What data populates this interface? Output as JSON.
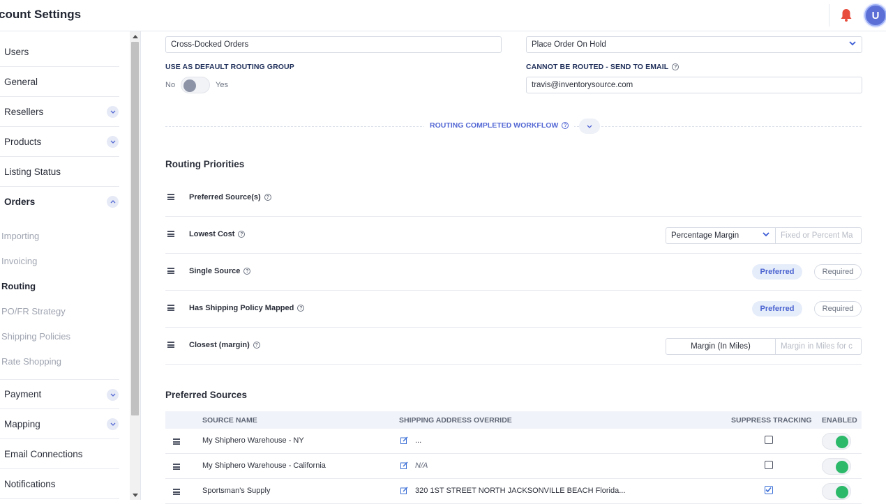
{
  "header": {
    "title": "count Settings",
    "avatar_letter": "U",
    "bell_color": "#e74c3c"
  },
  "sidebar": {
    "items": [
      {
        "label": "Users"
      },
      {
        "label": "General"
      },
      {
        "label": "Resellers"
      },
      {
        "label": "Products"
      },
      {
        "label": "Listing Status"
      },
      {
        "label": "Orders"
      },
      {
        "label": "Payment"
      },
      {
        "label": "Mapping"
      },
      {
        "label": "Email Connections"
      },
      {
        "label": "Notifications"
      }
    ],
    "sub_items": [
      {
        "label": "Importing"
      },
      {
        "label": "Invoicing"
      },
      {
        "label": "Routing"
      },
      {
        "label": "PO/FR Strategy"
      },
      {
        "label": "Shipping Policies"
      },
      {
        "label": "Rate Shopping"
      }
    ]
  },
  "form": {
    "group_name_value": "Cross-Docked Orders",
    "hold_select_value": "Place Order On Hold",
    "default_group_label": "USE AS DEFAULT ROUTING GROUP",
    "toggle_no": "No",
    "toggle_yes": "Yes",
    "default_group_enabled": false,
    "cannot_route_label": "CANNOT BE ROUTED - SEND TO EMAIL",
    "email_value": "travis@inventorysource.com",
    "workflow_label": "ROUTING COMPLETED WORKFLOW"
  },
  "priorities": {
    "title": "Routing Priorities",
    "rows": [
      {
        "label": "Preferred Source(s)"
      },
      {
        "label": "Lowest Cost",
        "select_value": "Percentage Margin",
        "input_placeholder": "Fixed or Percent Ma"
      },
      {
        "label": "Single Source",
        "preferred": "Preferred",
        "required": "Required"
      },
      {
        "label": "Has Shipping Policy Mapped",
        "preferred": "Preferred",
        "required": "Required"
      },
      {
        "label": "Closest (margin)",
        "select_value": "Margin (In Miles)",
        "input_placeholder": "Margin in Miles for c"
      }
    ]
  },
  "sources": {
    "title": "Preferred Sources",
    "columns": [
      "SOURCE NAME",
      "SHIPPING ADDRESS OVERRIDE",
      "SUPPRESS TRACKING",
      "ENABLED"
    ],
    "rows": [
      {
        "name": "My Shiphero Warehouse - NY",
        "address": "...",
        "suppress": false,
        "enabled": true
      },
      {
        "name": "My Shiphero Warehouse - California",
        "address": "N/A",
        "suppress": false,
        "enabled": true
      },
      {
        "name": "Sportsman's Supply",
        "address": "320 1ST STREET NORTH JACKSONVILLE BEACH Florida...",
        "suppress": true,
        "enabled": true
      }
    ]
  },
  "colors": {
    "accent": "#5468d4",
    "enabled_green": "#2db96a"
  }
}
